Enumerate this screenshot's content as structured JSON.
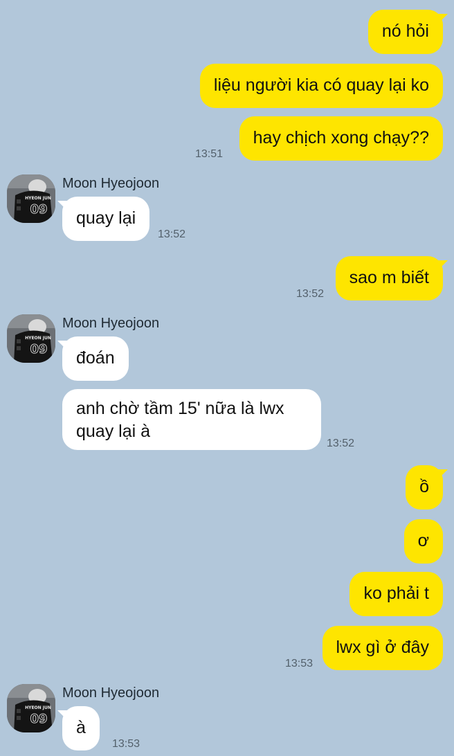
{
  "contact": {
    "name": "Moon Hyeojoon"
  },
  "avatar": {
    "jersey_text": "HYEON JUN",
    "jersey_number": "09"
  },
  "messages": [
    {
      "dir": "out",
      "text": "nó hỏi"
    },
    {
      "dir": "out",
      "text": "liệu người kia có quay lại ko"
    },
    {
      "dir": "out",
      "text": "hay chịch xong chạy??",
      "time": "13:51"
    },
    {
      "dir": "in",
      "sender": "Moon Hyeojoon",
      "text": "quay lại",
      "time": "13:52"
    },
    {
      "dir": "out",
      "text": "sao m biết",
      "time": "13:52"
    },
    {
      "dir": "in",
      "sender": "Moon Hyeojoon",
      "text": "đoán"
    },
    {
      "dir": "in",
      "text_line1": "anh chờ tầm 15' nữa là lwx",
      "text_line2": "quay lại à",
      "time": "13:52"
    },
    {
      "dir": "out",
      "text": "ồ"
    },
    {
      "dir": "out",
      "text": "ơ"
    },
    {
      "dir": "out",
      "text": "ko phải t"
    },
    {
      "dir": "out",
      "text": "lwx gì ở đây",
      "time": "13:53"
    },
    {
      "dir": "in",
      "sender": "Moon Hyeojoon",
      "text": "à",
      "time": "13:53"
    }
  ],
  "colors": {
    "background": "#b2c7da",
    "outgoing_bubble": "#fee500",
    "incoming_bubble": "#ffffff"
  }
}
